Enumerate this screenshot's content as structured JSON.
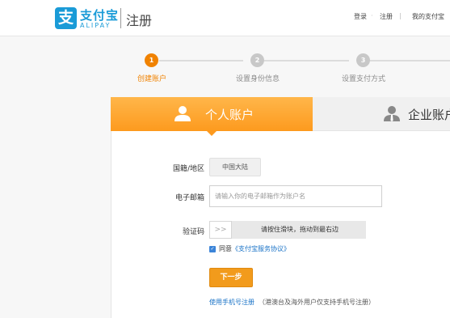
{
  "header": {
    "logo_mark": "支",
    "logo_cn": "支付宝",
    "logo_en": "ALIPAY",
    "page_name": "注册",
    "nav": {
      "login": "登录",
      "separator": "·",
      "register": "注册",
      "bar": "|",
      "my_alipay": "我的支付宝"
    }
  },
  "steps": [
    {
      "number": "1",
      "label": "创建账户",
      "active": true
    },
    {
      "number": "2",
      "label": "设置身份信息",
      "active": false
    },
    {
      "number": "3",
      "label": "设置支付方式",
      "active": false
    }
  ],
  "tabs": {
    "personal": "个人账户",
    "enterprise": "企业账户"
  },
  "form": {
    "region_label": "国籍/地区",
    "region_value": "中国大陆",
    "email_label": "电子邮箱",
    "email_placeholder": "请输入你的电子邮箱作为账户名",
    "captcha_label": "验证码",
    "slider_handle": ">>",
    "slider_text": "请按住滑块，拖动到最右边",
    "agree_prefix": "同意",
    "agree_link": "《支付宝服务协议》",
    "next_button": "下一步",
    "phone_link": "使用手机号注册",
    "phone_note": "（港澳台及海外用户仅支持手机号注册）"
  },
  "colors": {
    "brand_blue": "#1a9bd7",
    "accent_orange": "#f08200",
    "link_blue": "#1a73c7"
  }
}
